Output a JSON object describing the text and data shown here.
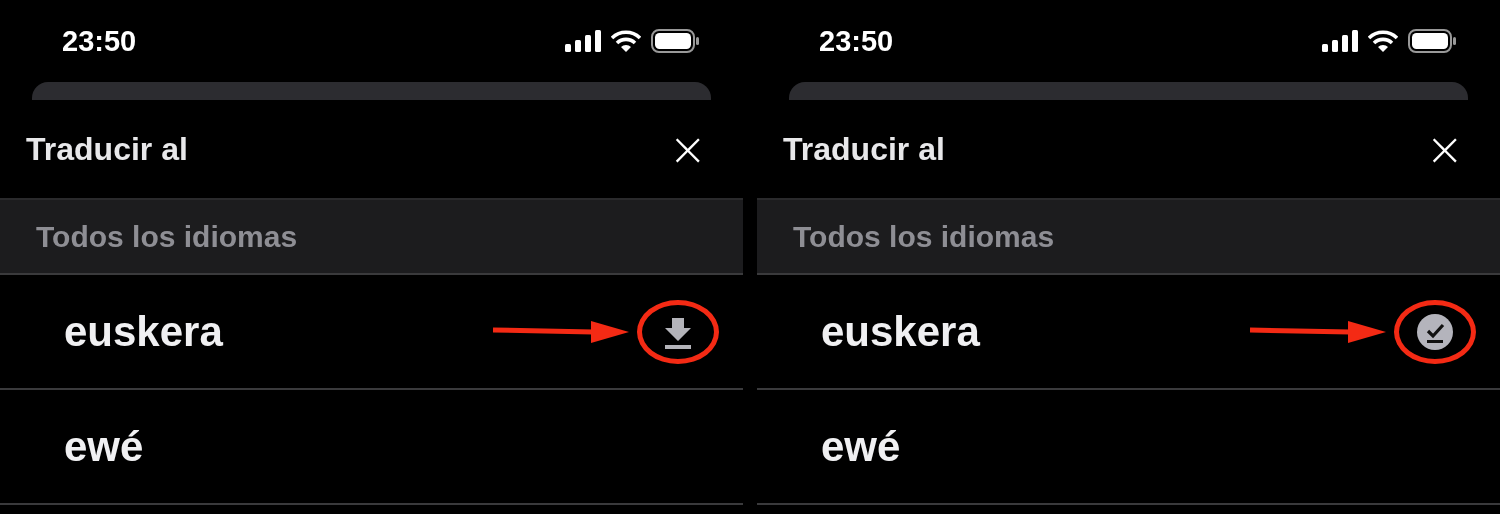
{
  "screens": [
    {
      "status_bar": {
        "time": "23:50"
      },
      "title": "Traducir al",
      "close": "×",
      "section": "Todos los idiomas",
      "languages": [
        {
          "name": "euskera",
          "kind": "download",
          "highlighted": true
        },
        {
          "name": "ewé",
          "kind": "none",
          "highlighted": false
        }
      ]
    },
    {
      "status_bar": {
        "time": "23:50"
      },
      "title": "Traducir al",
      "close": "×",
      "section": "Todos los idiomas",
      "languages": [
        {
          "name": "euskera",
          "kind": "downloaded",
          "highlighted": true
        },
        {
          "name": "ewé",
          "kind": "none",
          "highlighted": false
        }
      ]
    }
  ]
}
